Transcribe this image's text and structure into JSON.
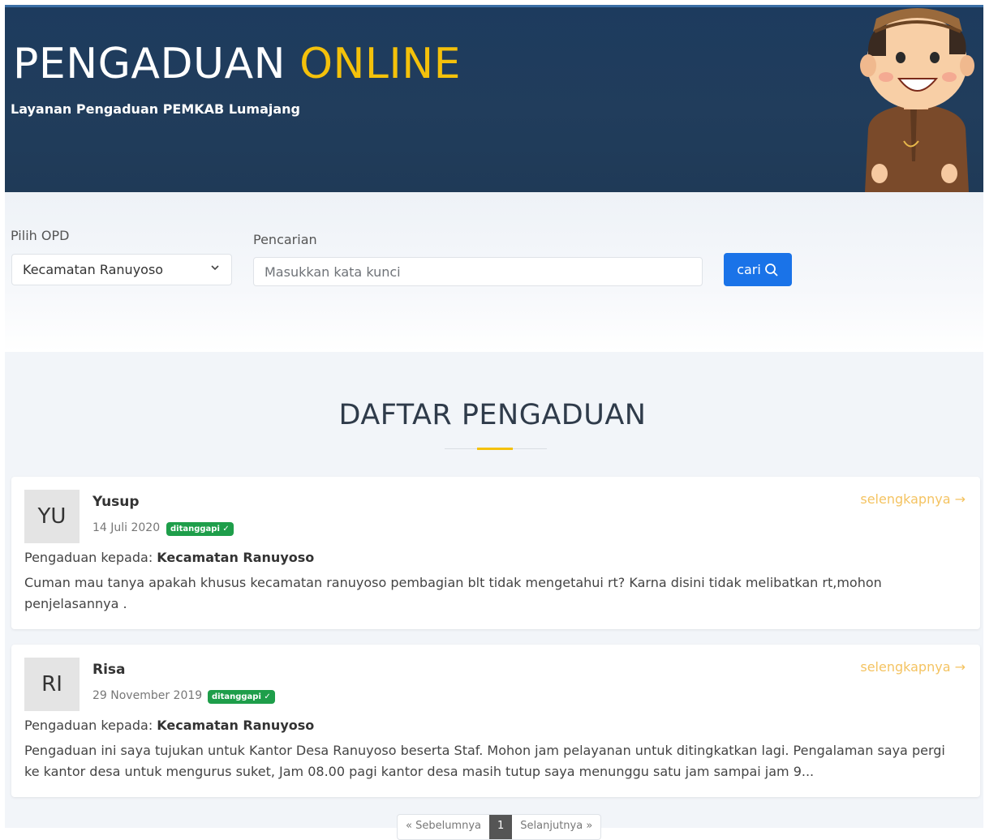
{
  "header": {
    "title_main": "PENGADUAN",
    "title_accent": "ONLINE",
    "tagline": "Layanan Pengaduan PEMKAB Lumajang",
    "colors": {
      "bg": "#1d3b5e",
      "accent": "#f4c10b"
    }
  },
  "filter": {
    "opd_label": "Pilih OPD",
    "opd_selected": "Kecamatan Ranuyoso",
    "search_label": "Pencarian",
    "search_placeholder": "Masukkan kata kunci",
    "search_button": "cari",
    "button_color": "#1a73e8"
  },
  "list": {
    "title": "DAFTAR PENGADUAN",
    "complaints": [
      {
        "initials": "YU",
        "name": "Yusup",
        "date": "14 Juli 2020",
        "badge": "ditanggapi ✓",
        "more": "selengkapnya →",
        "to_prefix": "Pengaduan kepada:",
        "to_target": "Kecamatan Ranuyoso",
        "text": "Cuman mau tanya apakah khusus kecamatan ranuyoso pembagian blt tidak mengetahui rt? Karna disini tidak melibatkan rt,mohon penjelasannya ."
      },
      {
        "initials": "RI",
        "name": "Risa",
        "date": "29 November 2019",
        "badge": "ditanggapi ✓",
        "more": "selengkapnya →",
        "to_prefix": "Pengaduan kepada:",
        "to_target": "Kecamatan Ranuyoso",
        "text": "Pengaduan ini saya tujukan untuk Kantor Desa Ranuyoso beserta Staf. Mohon jam pelayanan untuk ditingkatkan lagi. Pengalaman saya pergi ke kantor desa untuk mengurus suket, Jam 08.00 pagi kantor desa masih tutup saya menunggu satu jam sampai jam 9..."
      }
    ]
  },
  "pagination": {
    "prev": "« Sebelumnya",
    "current": "1",
    "next": "Selanjutnya »"
  }
}
